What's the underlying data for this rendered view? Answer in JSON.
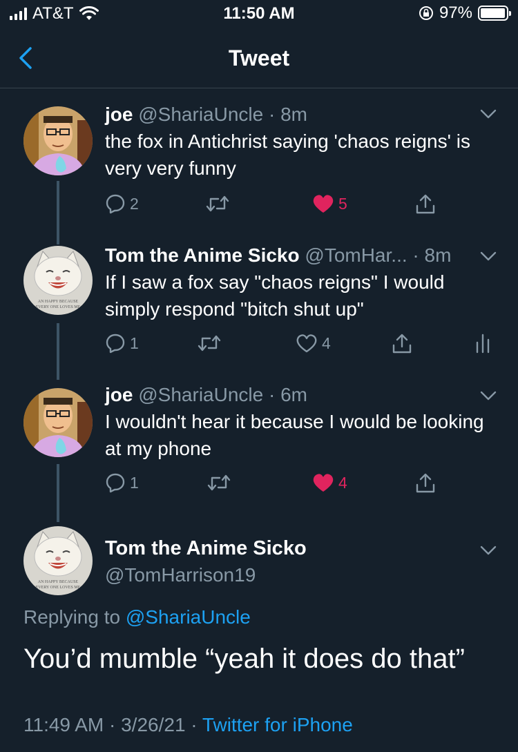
{
  "status_bar": {
    "carrier": "AT&T",
    "time": "11:50 AM",
    "battery": "97%",
    "battery_level": 0.97
  },
  "nav": {
    "title": "Tweet"
  },
  "tweets": [
    {
      "name": "joe",
      "handle": "@ShariaUncle",
      "sep": "·",
      "time": "8m",
      "text": "the fox in Antichrist saying 'chaos reigns' is very very funny",
      "replies": "2",
      "likes": "5",
      "liked": true
    },
    {
      "name": "Tom the Anime Sicko",
      "handle": "@TomHar...",
      "sep": "·",
      "time": "8m",
      "text": "If I saw a fox say \"chaos reigns\" I would simply respond \"bitch shut up\"",
      "replies": "1",
      "likes": "4",
      "liked": false
    },
    {
      "name": "joe",
      "handle": "@ShariaUncle",
      "sep": "·",
      "time": "6m",
      "text": "I wouldn't hear it because I would be looking at my phone",
      "replies": "1",
      "likes": "4",
      "liked": true
    }
  ],
  "main_tweet": {
    "name": "Tom the Anime Sicko",
    "handle": "@TomHarrison19",
    "replying_prefix": "Replying to",
    "replying_to": "@ShariaUncle",
    "text": "You’d mumble “yeah it does do that”",
    "timestamp": "11:49 AM · 3/26/21 ·",
    "source": "Twitter for iPhone"
  },
  "colors": {
    "background": "#15202b",
    "accent": "#1da1f2",
    "like": "#e0245e",
    "secondary_text": "#8899a6"
  },
  "icons": [
    "back-chevron-icon",
    "wifi-icon",
    "signal-icon",
    "rotation-lock-icon",
    "battery-icon",
    "reply-icon",
    "retweet-icon",
    "heart-icon",
    "share-icon",
    "analytics-icon",
    "caret-down-icon"
  ]
}
